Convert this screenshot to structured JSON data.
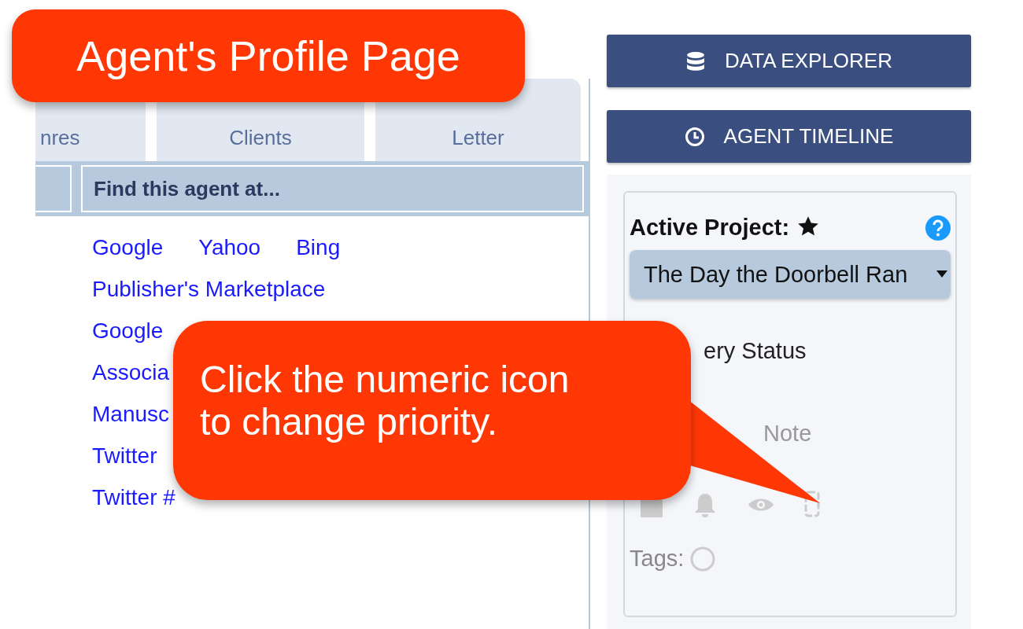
{
  "callouts": [
    {
      "kind": "title",
      "lines": [
        "Agent's Profile Page"
      ]
    },
    {
      "kind": "pointer",
      "lines": [
        "Click the numeric icon",
        "to change priority."
      ]
    }
  ],
  "tabs": [
    {
      "label": "nres"
    },
    {
      "label": "Clients"
    },
    {
      "label": "Letter"
    }
  ],
  "find_section": {
    "header": "Find this agent at...",
    "link_rows": [
      [
        "Google",
        "Yahoo",
        "Bing"
      ],
      [
        "Publisher's Marketplace"
      ],
      [
        "Google"
      ],
      [
        "Associa"
      ],
      [
        "Manusc"
      ],
      [
        "Twitter"
      ],
      [
        "Twitter #"
      ]
    ]
  },
  "sidebar": {
    "buttons": [
      {
        "label": "DATA EXPLORER",
        "kind": "database"
      },
      {
        "label": "AGENT TIMELINE",
        "kind": "clock"
      }
    ],
    "project": {
      "label": "Active Project:",
      "select_value": "The Day the Doorbell Ran",
      "query_status": "ery Status",
      "query_note": "Note",
      "tags_label": "Tags:"
    }
  }
}
